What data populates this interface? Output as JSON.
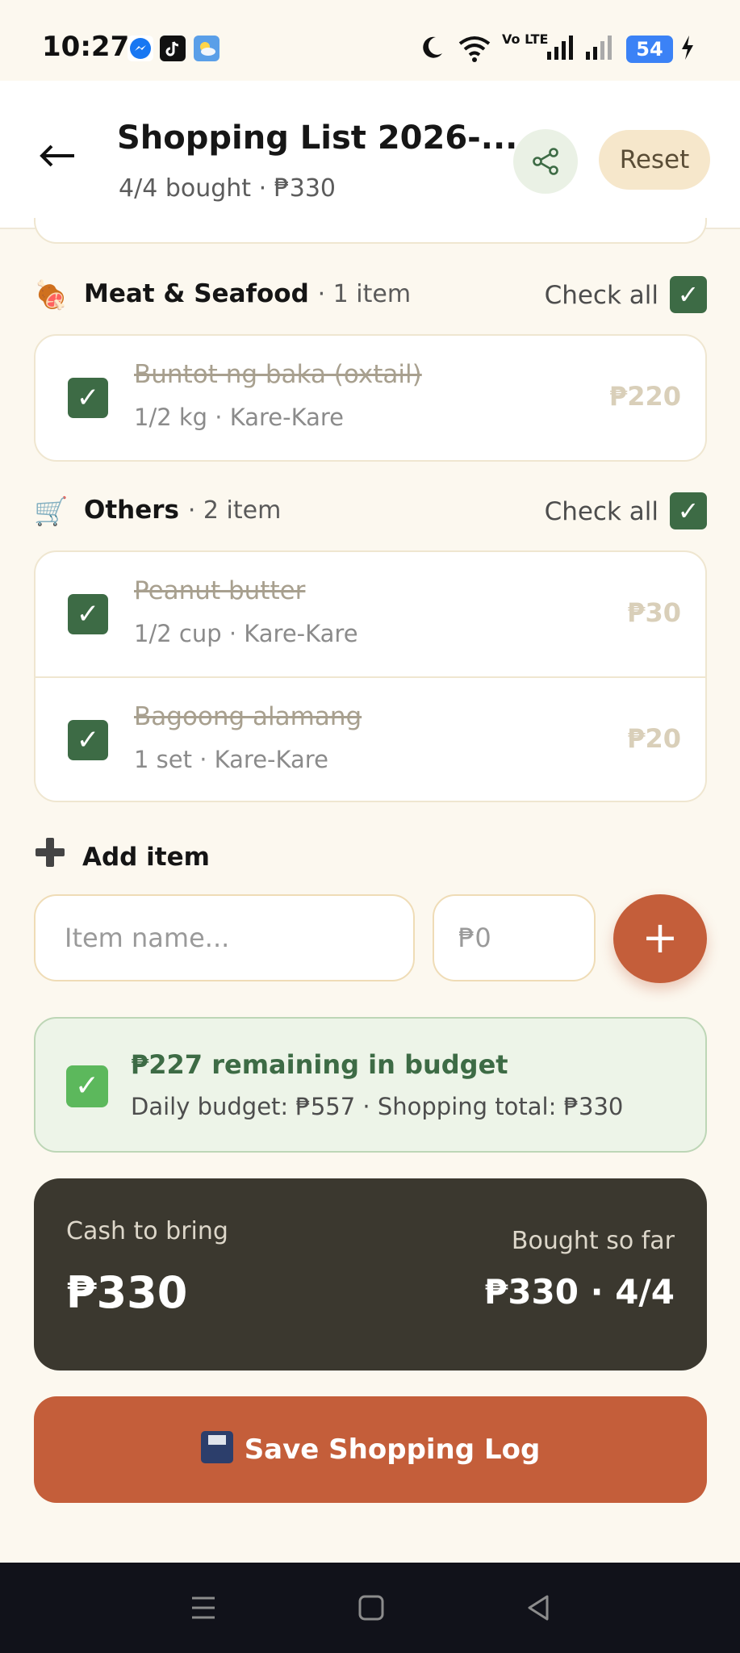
{
  "status_bar": {
    "time": "10:27",
    "network": "Vo LTE",
    "battery": "54",
    "icons": [
      "messenger-icon",
      "tiktok-icon",
      "weather-icon",
      "moon-icon",
      "wifi-icon",
      "signal-icon",
      "charging-icon"
    ]
  },
  "header": {
    "title": "Shopping List 2026-...",
    "subtitle": "4/4 bought · ₱330",
    "reset_label": "Reset"
  },
  "sections": [
    {
      "emoji": "🍖",
      "title": "Meat & Seafood",
      "count": "· 1 item",
      "check_all": "Check all",
      "items": [
        {
          "name": "Buntot ng baka (oxtail)",
          "detail": "1/2 kg · Kare-Kare",
          "price": "₱220",
          "checked": true
        }
      ]
    },
    {
      "emoji": "🛒",
      "title": "Others",
      "count": "· 2 item",
      "check_all": "Check all",
      "items": [
        {
          "name": "Peanut butter",
          "detail": "1/2 cup · Kare-Kare",
          "price": "₱30",
          "checked": true
        },
        {
          "name": "Bagoong alamang",
          "detail": "1 set · Kare-Kare",
          "price": "₱20",
          "checked": true
        }
      ]
    }
  ],
  "add_item": {
    "title": "Add item",
    "name_placeholder": "Item name...",
    "price_placeholder": "₱0",
    "add_symbol": "+"
  },
  "budget": {
    "title": "₱227 remaining in budget",
    "detail": "Daily budget: ₱557 · Shopping total: ₱330"
  },
  "cash": {
    "label": "Cash to bring",
    "value": "₱330",
    "bought_label": "Bought so far",
    "bought_value": "₱330 · 4/4"
  },
  "save_label": "Save Shopping Log",
  "colors": {
    "accent": "#c45e3a",
    "green": "#3d6b45",
    "background": "#fcf8ef",
    "dark_card": "#3b382f"
  }
}
